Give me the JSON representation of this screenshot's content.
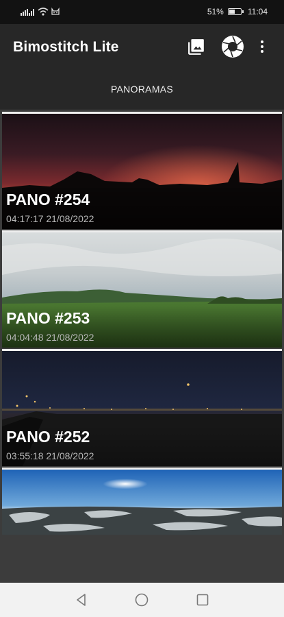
{
  "status_bar": {
    "time": "11:04",
    "battery_percent": "51%",
    "battery_level": 0.51
  },
  "app_bar": {
    "title": "Bimostitch Lite",
    "actions": [
      {
        "icon": "gallery-icon"
      },
      {
        "icon": "camera-shutter-icon"
      },
      {
        "icon": "more-vert-icon"
      }
    ]
  },
  "tabs": [
    {
      "label": "PANORAMAS"
    }
  ],
  "panoramas": [
    {
      "title": "PANO #254",
      "date": "04:17:17 21/08/2022"
    },
    {
      "title": "PANO #253",
      "date": "04:04:48 21/08/2022"
    },
    {
      "title": "PANO #252",
      "date": "03:55:18 21/08/2022"
    },
    {
      "title": "",
      "date": ""
    }
  ],
  "colors": {
    "background": "#2b2b2b",
    "app_bar": "#272727",
    "status_bar": "#121212",
    "nav_bar": "#f2f2f2"
  }
}
